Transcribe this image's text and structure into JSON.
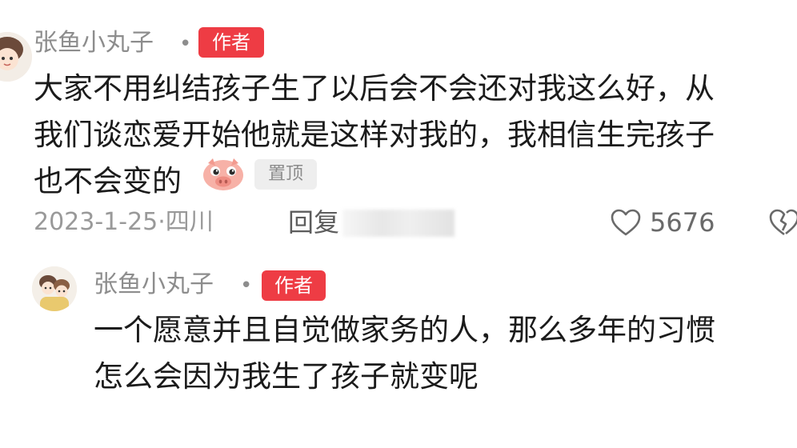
{
  "comment": {
    "username": "张鱼小丸子",
    "separator": "•",
    "author_badge": "作者",
    "lines": [
      "大家不用纠结孩子生了以后会不会还对我这么好，从",
      "我们谈恋爱开始他就是这样对我的，我相信生完孩子",
      "也不会变的"
    ],
    "emoji_icon": "pig-face-icon",
    "pinned_badge": "置顶",
    "date_location": "2023-1-25·四川",
    "reply_label": "回复",
    "like_count": "5676",
    "like_icon": "heart-outline-icon",
    "dislike_icon": "broken-heart-icon"
  },
  "reply": {
    "username": "张鱼小丸子",
    "separator": "•",
    "author_badge": "作者",
    "lines": [
      "一个愿意并且自觉做家务的人，那么多年的习惯",
      "怎么会因为我生了孩子就变呢"
    ]
  },
  "colors": {
    "author_badge_bg": "#ee3c44",
    "muted_text": "#8d8d8d",
    "body_text": "#1b1b1b"
  }
}
